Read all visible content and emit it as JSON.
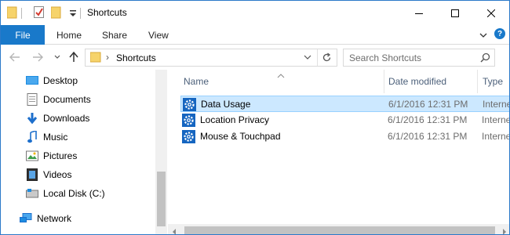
{
  "window": {
    "title": "Shortcuts",
    "accent": "#1979ca"
  },
  "ribbon": {
    "file_label": "File",
    "tabs": [
      "Home",
      "Share",
      "View"
    ]
  },
  "address": {
    "path": "Shortcuts",
    "search_placeholder": "Search Shortcuts"
  },
  "navpane": {
    "items": [
      {
        "label": "Desktop",
        "icon": "desktop-icon"
      },
      {
        "label": "Documents",
        "icon": "documents-icon"
      },
      {
        "label": "Downloads",
        "icon": "downloads-icon"
      },
      {
        "label": "Music",
        "icon": "music-icon"
      },
      {
        "label": "Pictures",
        "icon": "pictures-icon"
      },
      {
        "label": "Videos",
        "icon": "videos-icon"
      },
      {
        "label": "Local Disk (C:)",
        "icon": "local-disk-icon"
      },
      {
        "label": "Network",
        "icon": "network-icon"
      }
    ]
  },
  "columns": {
    "name": "Name",
    "date": "Date modified",
    "type": "Type"
  },
  "files": [
    {
      "name": "Data Usage",
      "date": "6/1/2016 12:31 PM",
      "type": "Interne",
      "selected": true
    },
    {
      "name": "Location Privacy",
      "date": "6/1/2016 12:31 PM",
      "type": "Interne",
      "selected": false
    },
    {
      "name": "Mouse & Touchpad",
      "date": "6/1/2016 12:31 PM",
      "type": "Interne",
      "selected": false
    }
  ]
}
